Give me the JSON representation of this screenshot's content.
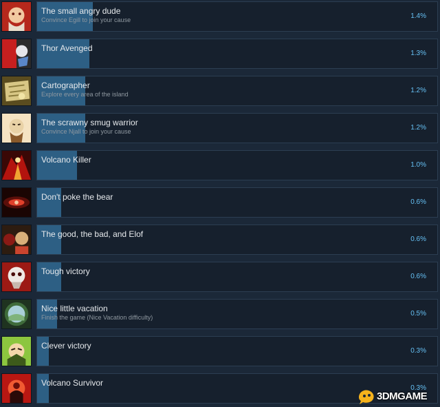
{
  "achievements": [
    {
      "title": "The small angry dude",
      "description": "Convince Egill to join your cause",
      "percent_label": "1.4%",
      "percent": 1.4,
      "icon": "angry-dwarf-portrait-icon",
      "palette": [
        "#b5281c",
        "#f2c9a1",
        "#e8dccb",
        "#6a1b12"
      ]
    },
    {
      "title": "Thor Avenged",
      "description": "",
      "percent_label": "1.3%",
      "percent": 1.3,
      "icon": "thor-avenged-icon",
      "palette": [
        "#c61f1f",
        "#2b2b2b",
        "#e6e6ea",
        "#5a87c8"
      ]
    },
    {
      "title": "Cartographer",
      "description": "Explore every area of the island",
      "percent_label": "1.2%",
      "percent": 1.2,
      "icon": "map-scroll-icon",
      "palette": [
        "#8a7a3a",
        "#d8c785",
        "#5a4c1f",
        "#f1e4a6"
      ]
    },
    {
      "title": "The scrawny smug warrior",
      "description": "Convince Njall to join your cause",
      "percent_label": "1.2%",
      "percent": 1.2,
      "icon": "smug-warrior-portrait-icon",
      "palette": [
        "#e9d2a6",
        "#f5e3c2",
        "#8a5a2b",
        "#3b2a1a"
      ]
    },
    {
      "title": "Volcano Killer",
      "description": "",
      "percent_label": "1.0%",
      "percent": 1.0,
      "icon": "volcano-fire-icon",
      "palette": [
        "#b3140e",
        "#f0a432",
        "#3a0806",
        "#f9e39a"
      ]
    },
    {
      "title": "Don't poke the bear",
      "description": "",
      "percent_label": "0.6%",
      "percent": 0.6,
      "icon": "bear-eye-icon",
      "palette": [
        "#5a0f0a",
        "#e0402a",
        "#f6c8a0",
        "#1a0503"
      ]
    },
    {
      "title": "The good, the bad, and Elof",
      "description": "",
      "percent_label": "0.6%",
      "percent": 0.6,
      "icon": "three-heroes-icon",
      "palette": [
        "#8b1a15",
        "#d9b07a",
        "#2d1c10",
        "#c9442e"
      ]
    },
    {
      "title": "Tough victory",
      "description": "",
      "percent_label": "0.6%",
      "percent": 0.6,
      "icon": "bloody-skull-icon",
      "palette": [
        "#9c1a14",
        "#efe9e4",
        "#4a0b08",
        "#c7b8ae"
      ]
    },
    {
      "title": "Nice little vacation",
      "description": "Finish the game (Nice Vacation difficulty)",
      "percent_label": "0.5%",
      "percent": 0.5,
      "icon": "island-lens-icon",
      "palette": [
        "#3e6b3a",
        "#a9d0d8",
        "#1f3320",
        "#7fb37a"
      ]
    },
    {
      "title": "Clever victory",
      "description": "",
      "percent_label": "0.3%",
      "percent": 0.3,
      "icon": "clever-dwarf-portrait-icon",
      "palette": [
        "#8cc63f",
        "#f3d7a9",
        "#3d5a1a",
        "#2c1f12"
      ]
    },
    {
      "title": "Volcano Survivor",
      "description": "",
      "percent_label": "0.3%",
      "percent": 0.3,
      "icon": "volcano-survivor-icon",
      "palette": [
        "#b81712",
        "#2a0a08",
        "#f15a32",
        "#6b0d09"
      ]
    }
  ],
  "watermark": {
    "text": "3DMGAME",
    "icon": "3dmgame-logo-icon",
    "color": "#f5b21c"
  },
  "colors": {
    "background": "#1b2838",
    "panel": "#16202d",
    "panel_border": "#2c3e52",
    "progress_bar": "#2d5f84",
    "title_text": "#e6e9ec",
    "description_text": "#8f98a0",
    "percent_text": "#66c0f4"
  }
}
